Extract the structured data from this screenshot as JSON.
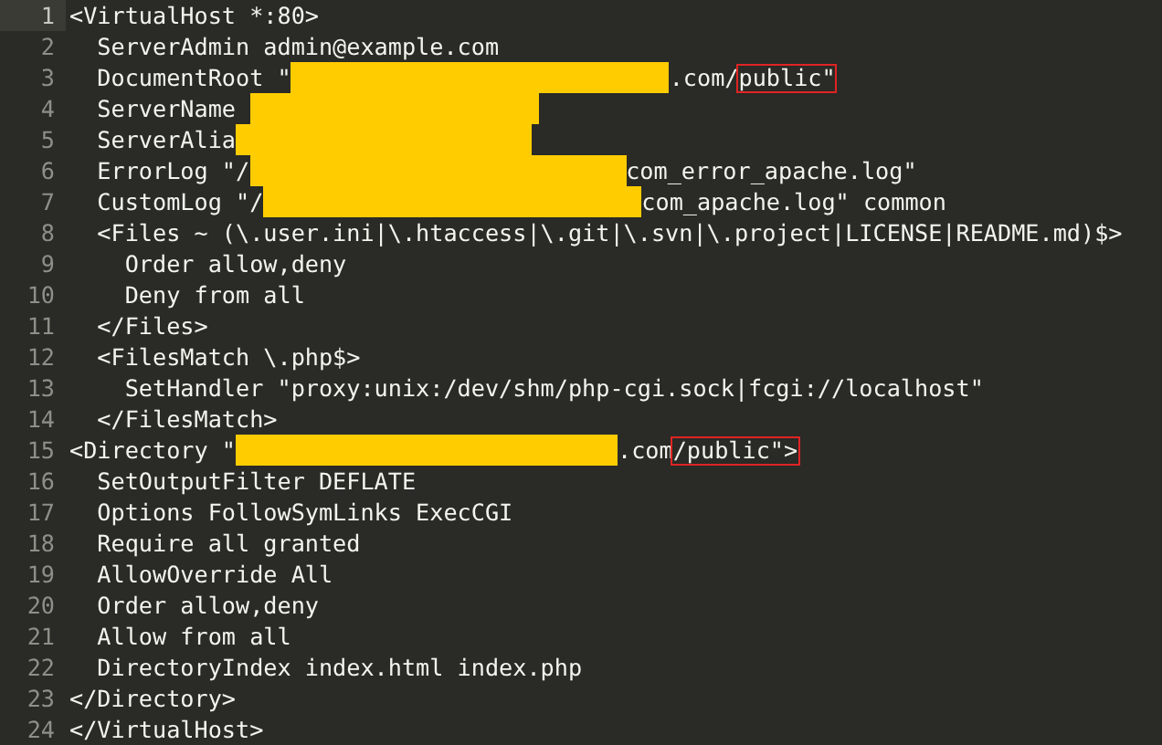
{
  "editor": {
    "lines": [
      {
        "number": "1",
        "current": true,
        "segments": [
          {
            "kind": "text",
            "text": "<VirtualHost *:80>"
          }
        ]
      },
      {
        "number": "2",
        "current": false,
        "segments": [
          {
            "kind": "text",
            "text": "  ServerAdmin admin@example.com"
          }
        ]
      },
      {
        "number": "3",
        "current": false,
        "segments": [
          {
            "kind": "text",
            "text": "  DocumentRoot \""
          },
          {
            "kind": "redacted"
          },
          {
            "kind": "text",
            "text": ".com/"
          },
          {
            "kind": "marked",
            "text": "public\""
          }
        ]
      },
      {
        "number": "4",
        "current": false,
        "segments": [
          {
            "kind": "text",
            "text": "  ServerName "
          },
          {
            "kind": "redacted"
          }
        ]
      },
      {
        "number": "5",
        "current": false,
        "segments": [
          {
            "kind": "text",
            "text": "  ServerAlia"
          },
          {
            "kind": "redacted"
          }
        ]
      },
      {
        "number": "6",
        "current": false,
        "segments": [
          {
            "kind": "text",
            "text": "  ErrorLog \"/"
          },
          {
            "kind": "redacted"
          },
          {
            "kind": "text",
            "text": "com_error_apache.log\""
          }
        ]
      },
      {
        "number": "7",
        "current": false,
        "segments": [
          {
            "kind": "text",
            "text": "  CustomLog \"/"
          },
          {
            "kind": "redacted"
          },
          {
            "kind": "text",
            "text": "com_apache.log\" common"
          }
        ]
      },
      {
        "number": "8",
        "current": false,
        "segments": [
          {
            "kind": "text",
            "text": "  <Files ~ (\\.user.ini|\\.htaccess|\\.git|\\.svn|\\.project|LICENSE|README.md)$>"
          }
        ]
      },
      {
        "number": "9",
        "current": false,
        "segments": [
          {
            "kind": "text",
            "text": "    Order allow,deny"
          }
        ]
      },
      {
        "number": "10",
        "current": false,
        "segments": [
          {
            "kind": "text",
            "text": "    Deny from all"
          }
        ]
      },
      {
        "number": "11",
        "current": false,
        "segments": [
          {
            "kind": "text",
            "text": "  </Files>"
          }
        ]
      },
      {
        "number": "12",
        "current": false,
        "segments": [
          {
            "kind": "text",
            "text": "  <FilesMatch \\.php$>"
          }
        ]
      },
      {
        "number": "13",
        "current": false,
        "segments": [
          {
            "kind": "text",
            "text": "    SetHandler \"proxy:unix:/dev/shm/php-cgi.sock|fcgi://localhost\""
          }
        ]
      },
      {
        "number": "14",
        "current": false,
        "segments": [
          {
            "kind": "text",
            "text": "  </FilesMatch>"
          }
        ]
      },
      {
        "number": "15",
        "current": false,
        "segments": [
          {
            "kind": "text",
            "text": "<Directory \""
          },
          {
            "kind": "redacted"
          },
          {
            "kind": "text",
            "text": ".com"
          },
          {
            "kind": "marked",
            "text": "/public\">"
          }
        ]
      },
      {
        "number": "16",
        "current": false,
        "segments": [
          {
            "kind": "text",
            "text": "  SetOutputFilter DEFLATE"
          }
        ]
      },
      {
        "number": "17",
        "current": false,
        "segments": [
          {
            "kind": "text",
            "text": "  Options FollowSymLinks ExecCGI"
          }
        ]
      },
      {
        "number": "18",
        "current": false,
        "segments": [
          {
            "kind": "text",
            "text": "  Require all granted"
          }
        ]
      },
      {
        "number": "19",
        "current": false,
        "segments": [
          {
            "kind": "text",
            "text": "  AllowOverride All"
          }
        ]
      },
      {
        "number": "20",
        "current": false,
        "segments": [
          {
            "kind": "text",
            "text": "  Order allow,deny"
          }
        ]
      },
      {
        "number": "21",
        "current": false,
        "segments": [
          {
            "kind": "text",
            "text": "  Allow from all"
          }
        ]
      },
      {
        "number": "22",
        "current": false,
        "segments": [
          {
            "kind": "text",
            "text": "  DirectoryIndex index.html index.php"
          }
        ]
      },
      {
        "number": "23",
        "current": false,
        "segments": [
          {
            "kind": "text",
            "text": "</Directory>"
          }
        ]
      },
      {
        "number": "24",
        "current": false,
        "segments": [
          {
            "kind": "text",
            "text": "</VirtualHost>"
          }
        ]
      }
    ]
  }
}
